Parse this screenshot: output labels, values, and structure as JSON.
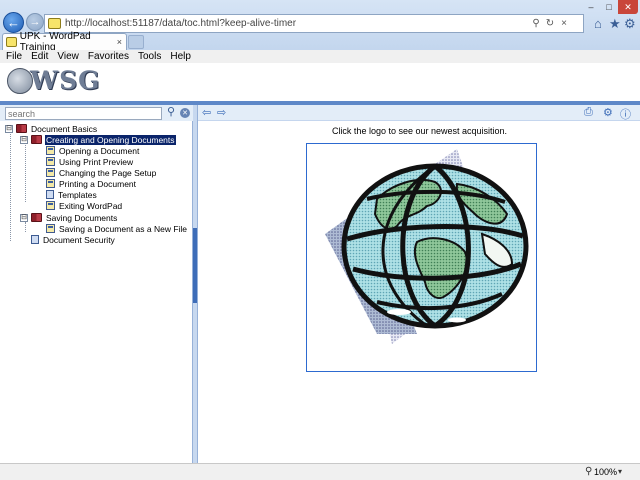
{
  "browser": {
    "address_url": "http://localhost:51187/data/toc.html?keep-alive-timer",
    "tab_title": "UPK - WordPad Training",
    "tab_close": "×"
  },
  "menubar": [
    "File",
    "Edit",
    "View",
    "Favorites",
    "Tools",
    "Help"
  ],
  "banner": {
    "logo_text": "WSG"
  },
  "search": {
    "placeholder": "search"
  },
  "toc": [
    {
      "label": "Document Basics",
      "toggle": "⊟",
      "icon": "book-icon"
    },
    {
      "label": "Creating and Opening Documents",
      "toggle": "⊟",
      "icon": "book-icon",
      "selected": true
    },
    {
      "label": "Opening a Document",
      "icon": "topic-icon"
    },
    {
      "label": "Using Print Preview",
      "icon": "topic-icon"
    },
    {
      "label": "Changing the Page Setup",
      "icon": "topic-icon"
    },
    {
      "label": "Printing a Document",
      "icon": "topic-icon"
    },
    {
      "label": "Templates",
      "icon": "doc-icon"
    },
    {
      "label": "Exiting WordPad",
      "icon": "topic-icon"
    },
    {
      "label": "Saving Documents",
      "toggle": "⊟",
      "icon": "book-icon"
    },
    {
      "label": "Saving a Document as a New File",
      "icon": "topic-icon"
    },
    {
      "label": "Document Security",
      "icon": "doc-icon"
    }
  ],
  "content": {
    "caption": "Click the logo to see our newest acquisition."
  },
  "status": {
    "zoom": "100%"
  },
  "colors": {
    "selection": "#0a246a",
    "panel_border": "#97b1d8",
    "banner_band": "#5e88c8"
  }
}
